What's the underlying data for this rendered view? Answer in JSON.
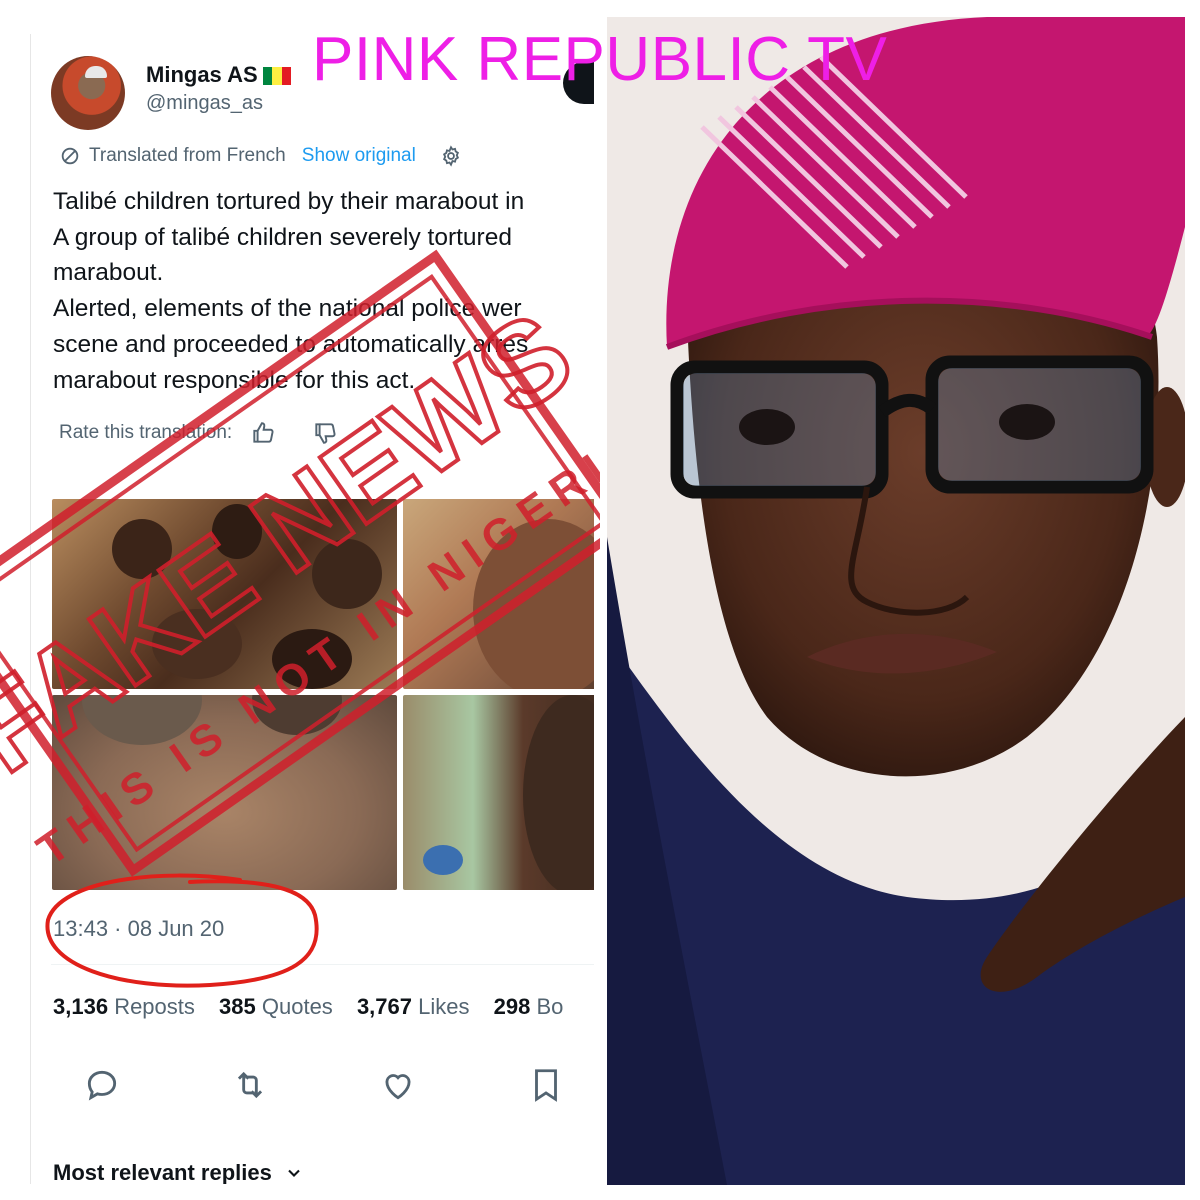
{
  "header": {
    "title": "PINK REPUBLIC TV"
  },
  "tweet": {
    "display_name": "Mingas AS",
    "handle": "@mingas_as",
    "translation_note": "Translated from French",
    "show_original_label": "Show original",
    "body_lines": [
      "Talibé children tortured by their marabout in",
      "A group of talibé children severely tortured",
      "marabout.",
      "Alerted, elements of the national police wer",
      "scene and proceeded to automatically arres",
      "marabout responsible for this act."
    ],
    "rate_label": "Rate this translation:",
    "timestamp": "13:43 · 08 Jun 20",
    "stats": [
      {
        "value": "3,136",
        "label": "Reposts"
      },
      {
        "value": "385",
        "label": "Quotes"
      },
      {
        "value": "3,767",
        "label": "Likes"
      },
      {
        "value": "298",
        "label": "Bo"
      }
    ],
    "replies_label": "Most relevant replies"
  },
  "stamp": {
    "main": "FAKE NEWS",
    "sub": "THIS IS NOT IN NIGERIA"
  },
  "colors": {
    "accent_pink": "#ee1fe6",
    "stamp_red": "#d01f2b",
    "link_blue": "#1d9bf0",
    "circle_red": "#e0201a"
  },
  "icons": [
    "translate-icon",
    "gear-icon",
    "thumbs-up-icon",
    "thumbs-down-icon",
    "reply-icon",
    "repost-icon",
    "like-icon",
    "bookmark-icon",
    "chevron-down-icon",
    "senegal-flag-icon"
  ]
}
